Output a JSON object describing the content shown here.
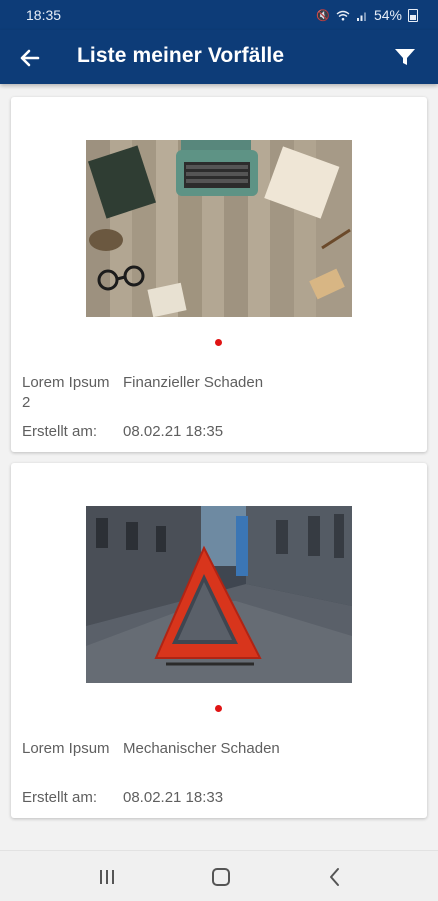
{
  "status_bar": {
    "time": "18:35",
    "battery": "54%",
    "icons": [
      "mute-icon",
      "wifi-icon",
      "signal-icon",
      "battery-icon"
    ]
  },
  "app_bar": {
    "title": "Liste meiner Vorfälle",
    "back_icon": "arrow-left-icon",
    "filter_icon": "filter-icon",
    "background": "#0d3c78"
  },
  "incidents": [
    {
      "image": "typewriter-desk-photo",
      "status_color": "#e01414",
      "name": "Lorem Ipsum 2",
      "type": "Finanzieller Schaden",
      "created_label": "Erstellt am:",
      "created_value": "08.02.21 18:35"
    },
    {
      "image": "warning-triangle-street-photo",
      "status_color": "#e01414",
      "name": "Lorem Ipsum",
      "type": "Mechanischer Schaden",
      "created_label": "Erstellt am:",
      "created_value": "08.02.21 18:33"
    }
  ],
  "nav_bar": {
    "icons": [
      "recent-apps-icon",
      "home-icon",
      "back-icon"
    ]
  }
}
